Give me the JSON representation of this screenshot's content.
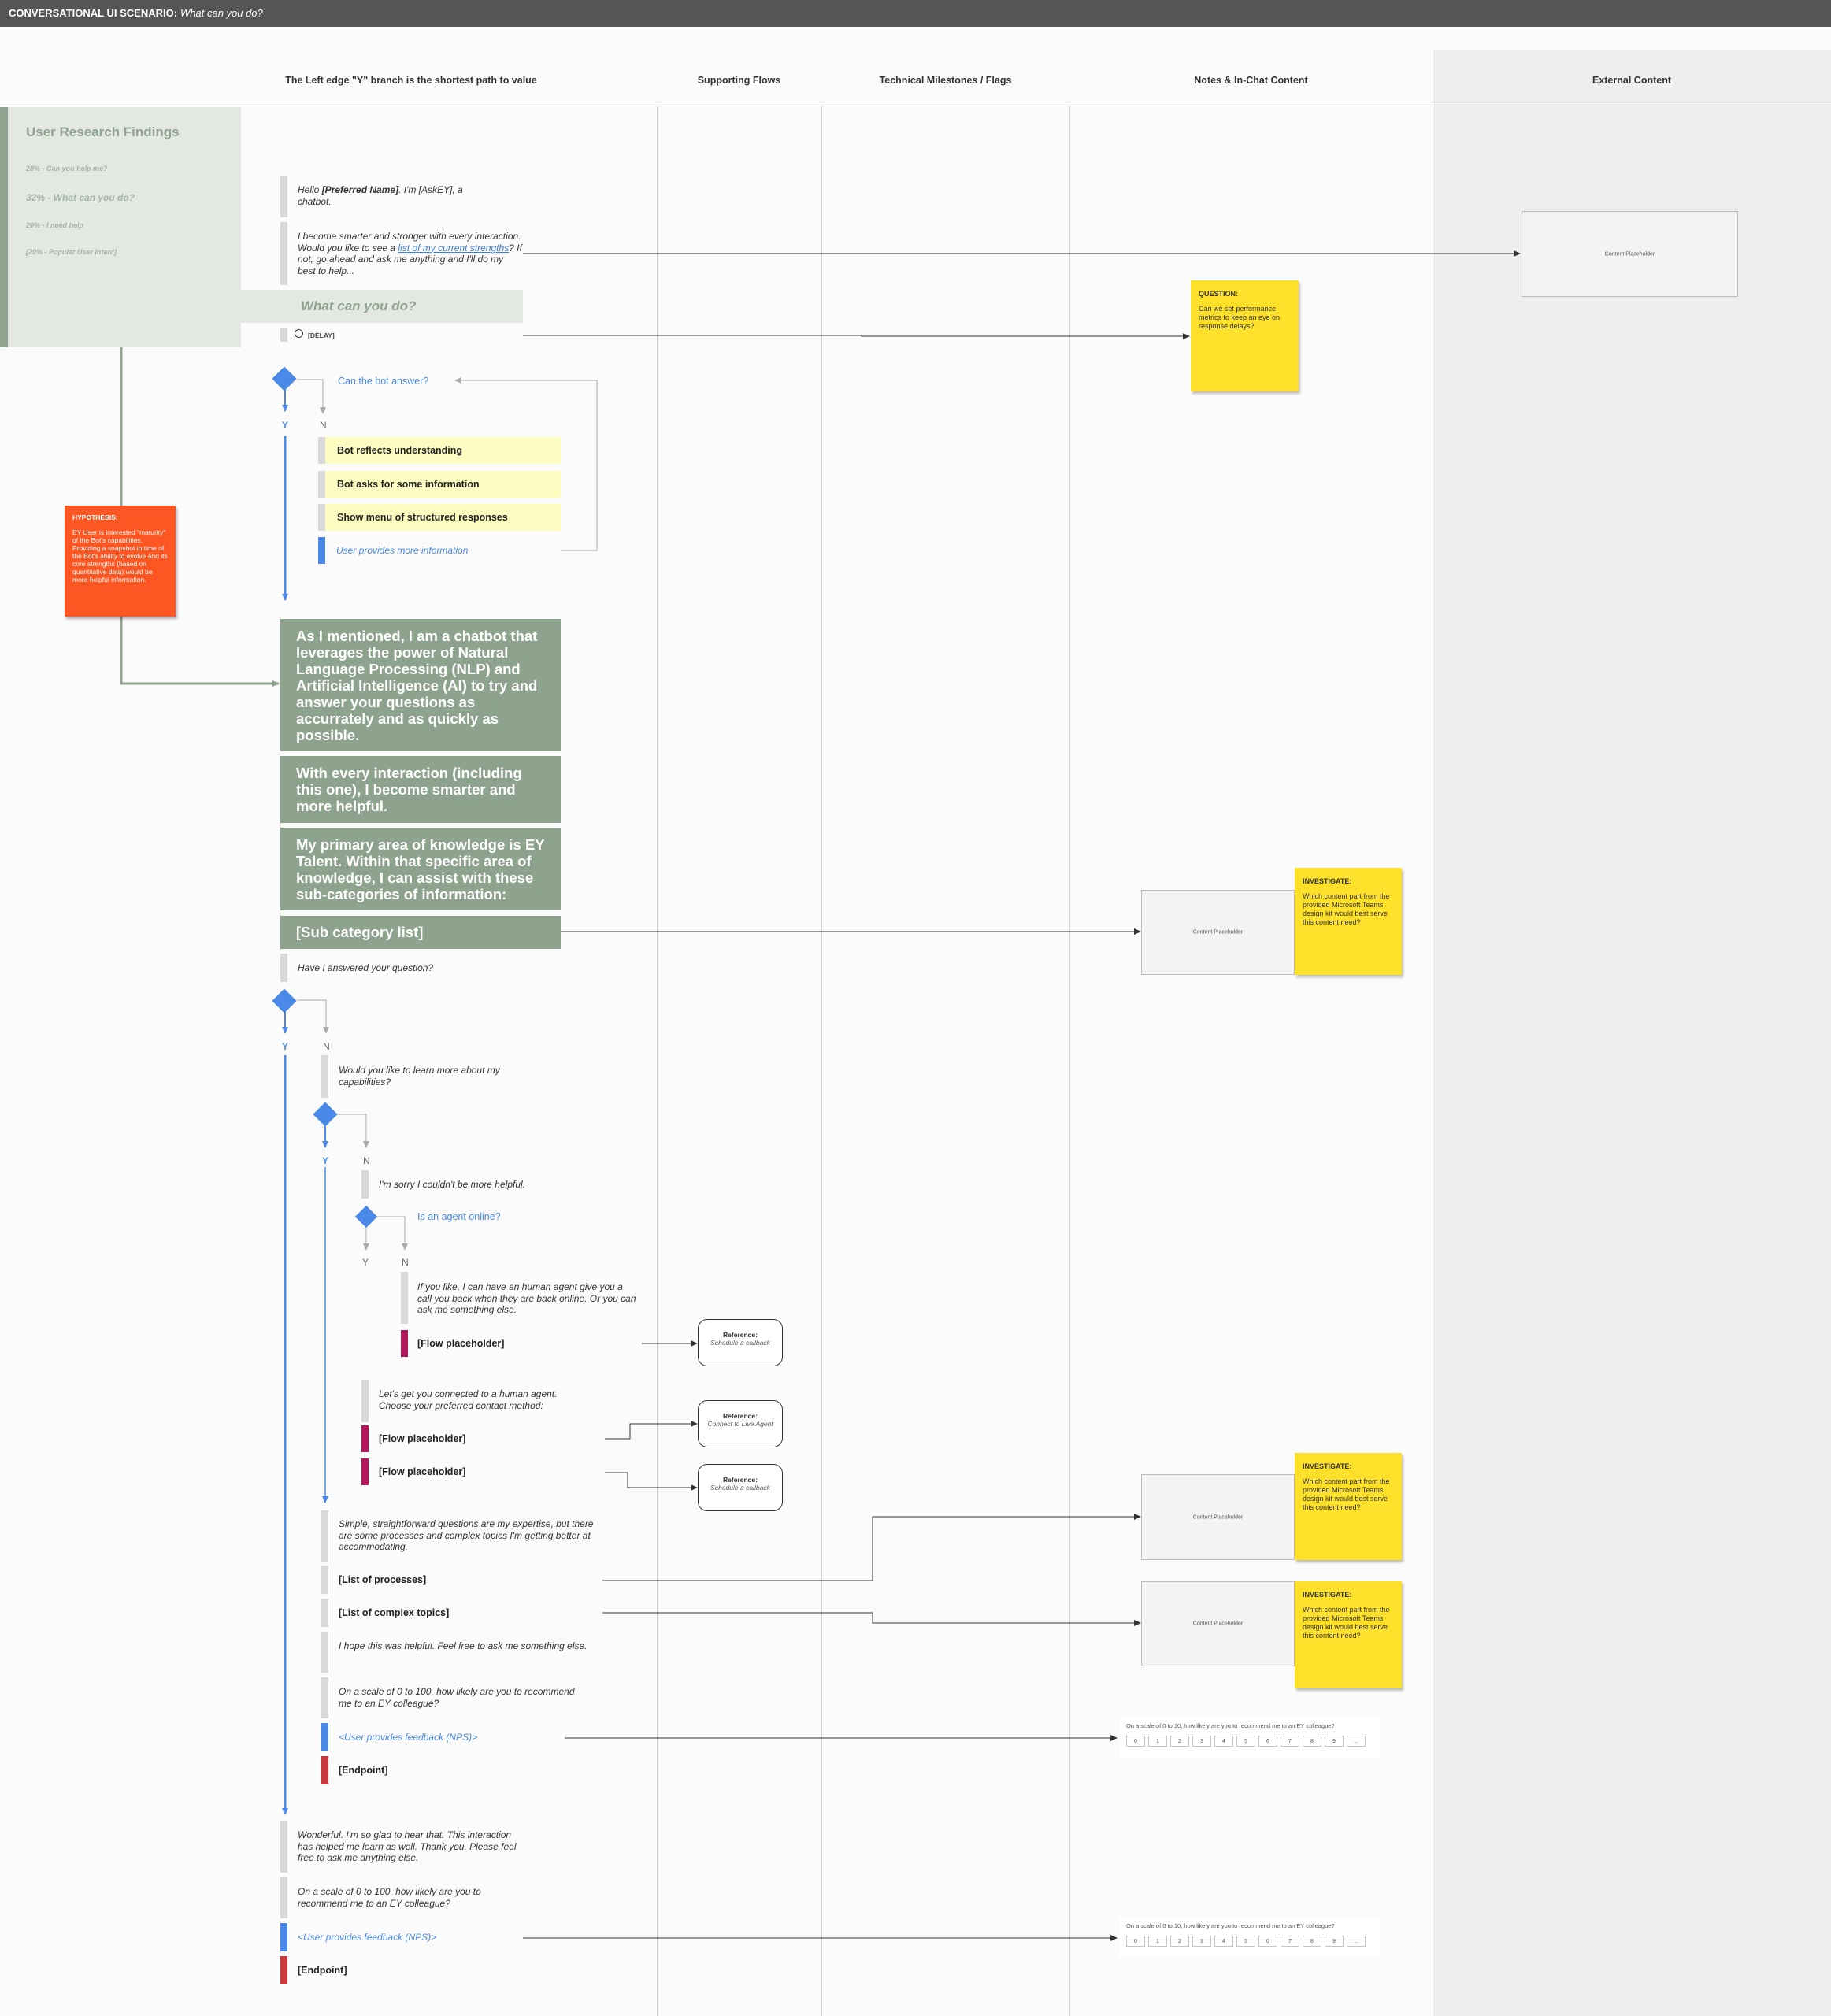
{
  "header": {
    "title_bold": "CONVERSATIONAL UI SCENARIO:",
    "title_italic": "What can you do?"
  },
  "columns": {
    "main": "The Left edge \"Y\" branch is the shortest path to value",
    "supporting": "Supporting Flows",
    "technical": "Technical Milestones / Flags",
    "notes": "Notes & In-Chat Content",
    "external": "External Content"
  },
  "research": {
    "title": "User Research Findings",
    "findings": [
      "28% - Can you help me?",
      "32% - What can you do?",
      "20% - I need help",
      "[20% - Popular User Intent]"
    ]
  },
  "user_query": "What can you do?",
  "chat": {
    "greeting_pre": "Hello ",
    "greeting_name": "[Preferred Name]",
    "greeting_post": ". I'm [AskEY], a chatbot.",
    "smarter_pre": "I become smarter and stronger with every interaction. Would you like to see a ",
    "smarter_link": "list of my current strengths",
    "smarter_post": "? If not, go ahead and ask me anything and I'll do my best to help...",
    "delay": "[DELAY]",
    "decision1": "Can the bot answer?",
    "y": "Y",
    "n": "N",
    "yellow_rows": [
      "Bot reflects understanding",
      "Bot asks for some information",
      "Show menu of structured responses"
    ],
    "user_more_info": "User provides more information",
    "green_blocks": [
      "As I mentioned, I am a chatbot that leverages the power of  Natural Language Processing (NLP) and Artificial Intelligence (AI) to try and answer your questions as accurrately and as quickly as possible.",
      "With every interaction (including this one), I become smarter and more helpful.",
      "My primary area of knowledge is EY Talent. Within that specific area of knowledge, I can assist with these sub-categories of information:",
      "[Sub category list]"
    ],
    "answered_q": "Have I answered your question?",
    "learn_more": "Would you like to learn more about my capabilities?",
    "sorry": "I'm sorry I couldn't be more helpful.",
    "agent_online": "Is an agent online?",
    "callback_offer": "If you like, I can have an human agent give you a call you back when they are back online. Or you can ask me something else.",
    "flow_placeholder": "[Flow placeholder]",
    "connect_agent": "Let's get you connected to a human agent. Choose your preferred contact method:",
    "simple_questions": "Simple, straightforward questions are my expertise, but there are some processes and complex topics I'm getting better at accommodating.",
    "list_processes": "[List of processes]",
    "list_complex": "[List of complex topics]",
    "hope_helpful": "I hope this was helpful. Feel free to ask me something else.",
    "scale_q": "On a scale of 0 to 100, how likely are you to recommend me to an EY colleague?",
    "nps_feedback": "<User provides feedback (NPS)>",
    "endpoint": "[Endpoint]",
    "wonderful": "Wonderful. I'm so glad to hear that. This interaction has helped me learn as well. Thank you. Please feel free to ask me anything else."
  },
  "notes": {
    "question_title": "QUESTION:",
    "question_body": "Can we set performance metrics to keep an eye on response delays?",
    "hypothesis_title": "HYPOTHESIS:",
    "hypothesis_body": "EY User is interested \"maturity\" of the Bot's capabilities. Providing a snapshot in time of the Bot's ability to evolve and its core strengths (based on quantitative data) would be more helpful information.",
    "investigate_title": "INVESTIGATE:",
    "investigate_body": "Which content part from the provided Microsoft Teams design kit would best serve this content need?"
  },
  "placeholders": {
    "content": "Content Placeholder"
  },
  "references": {
    "title": "Reference:",
    "callback": "Schedule a callback",
    "live_agent": "Connect to Live Agent"
  },
  "nps_widget": {
    "question": "On a scale of 0 to 10, how likely are you to recommend me to an EY colleague?",
    "options": [
      "0",
      "1",
      "2",
      "3",
      "4",
      "5",
      "6",
      "7",
      "8",
      "9",
      "..."
    ]
  }
}
